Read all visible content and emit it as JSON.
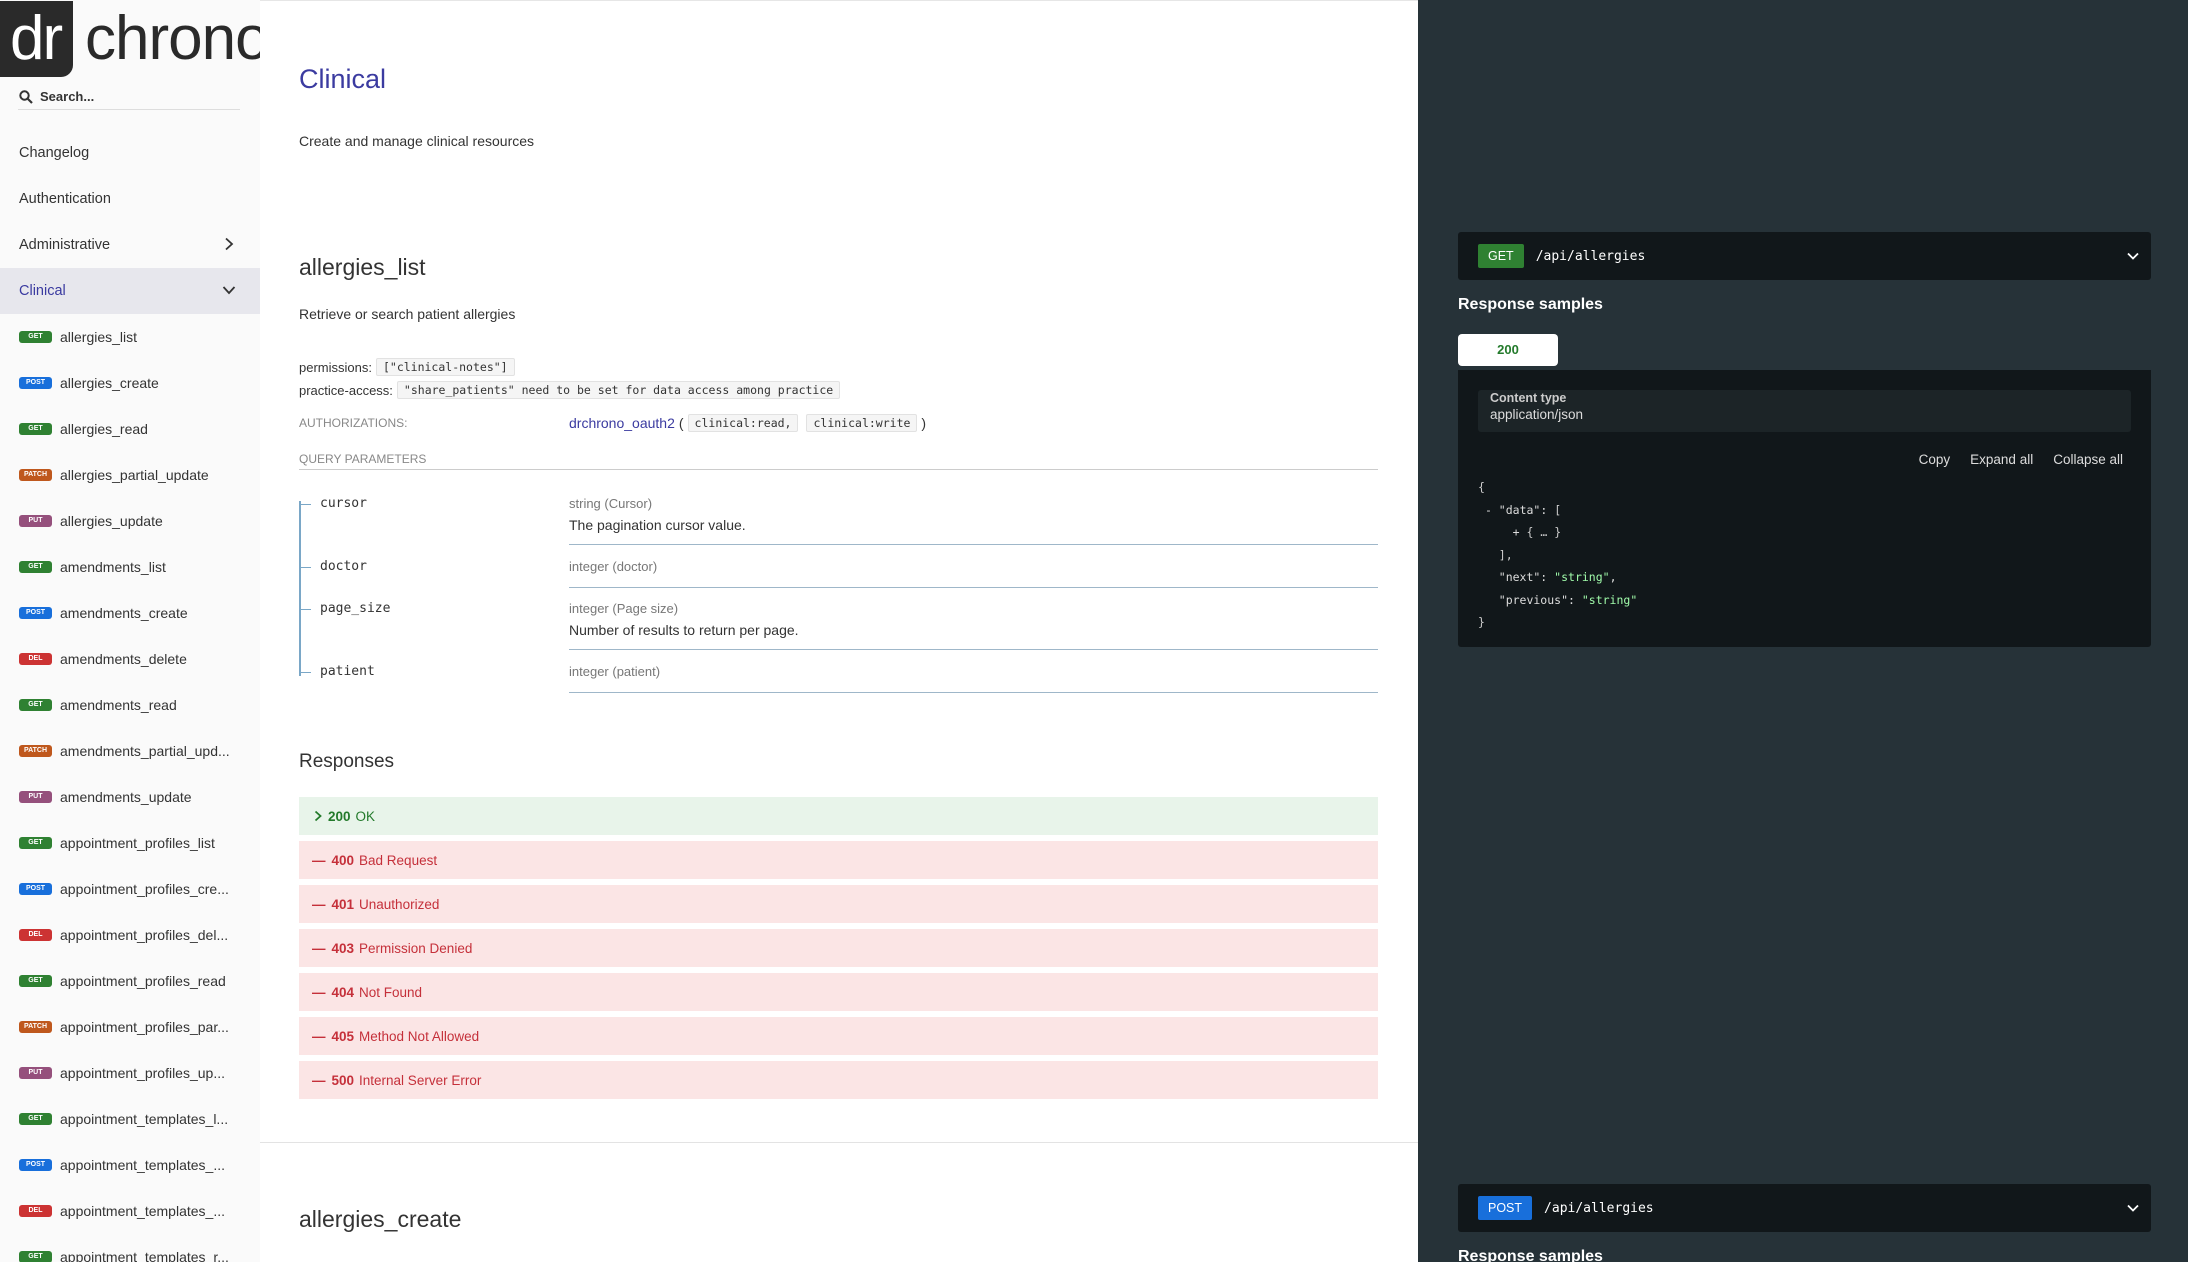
{
  "logo": {
    "box_text": "dr",
    "word": "chrono"
  },
  "search": {
    "placeholder": "Search..."
  },
  "nav": {
    "top_items": [
      {
        "label": "Changelog"
      },
      {
        "label": "Authentication"
      },
      {
        "label": "Administrative"
      },
      {
        "label": "Clinical"
      }
    ],
    "operations": [
      {
        "method": "GET",
        "label": "allergies_list"
      },
      {
        "method": "POST",
        "label": "allergies_create"
      },
      {
        "method": "GET",
        "label": "allergies_read"
      },
      {
        "method": "PATCH",
        "label": "allergies_partial_update"
      },
      {
        "method": "PUT",
        "label": "allergies_update"
      },
      {
        "method": "GET",
        "label": "amendments_list"
      },
      {
        "method": "POST",
        "label": "amendments_create"
      },
      {
        "method": "DEL",
        "label": "amendments_delete"
      },
      {
        "method": "GET",
        "label": "amendments_read"
      },
      {
        "method": "PATCH",
        "label": "amendments_partial_upd..."
      },
      {
        "method": "PUT",
        "label": "amendments_update"
      },
      {
        "method": "GET",
        "label": "appointment_profiles_list"
      },
      {
        "method": "POST",
        "label": "appointment_profiles_cre..."
      },
      {
        "method": "DEL",
        "label": "appointment_profiles_del..."
      },
      {
        "method": "GET",
        "label": "appointment_profiles_read"
      },
      {
        "method": "PATCH",
        "label": "appointment_profiles_par..."
      },
      {
        "method": "PUT",
        "label": "appointment_profiles_up..."
      },
      {
        "method": "GET",
        "label": "appointment_templates_l..."
      },
      {
        "method": "POST",
        "label": "appointment_templates_..."
      },
      {
        "method": "DEL",
        "label": "appointment_templates_..."
      },
      {
        "method": "GET",
        "label": "appointment_templates_r..."
      }
    ]
  },
  "main": {
    "section_title": "Clinical",
    "section_desc": "Create and manage clinical resources",
    "operation": {
      "title": "allergies_list",
      "desc": "Retrieve or search patient allergies",
      "permissions_label": "permissions:",
      "permissions_value": "[\"clinical-notes\"]",
      "practice_access_label": "practice-access:",
      "practice_access_value": "\"share_patients\" need to be set for data access among practice",
      "authorizations_label": "AUTHORIZATIONS:",
      "auth_name": "drchrono_oauth2",
      "auth_open": "(",
      "auth_close": ")",
      "auth_scopes": [
        "clinical:read,",
        "clinical:write"
      ],
      "query_params_label": "QUERY PARAMETERS",
      "params": [
        {
          "name": "cursor",
          "type": "string (Cursor)",
          "desc": "The pagination cursor value."
        },
        {
          "name": "doctor",
          "type": "integer (doctor)",
          "desc": ""
        },
        {
          "name": "page_size",
          "type": "integer (Page size)",
          "desc": "Number of results to return per page."
        },
        {
          "name": "patient",
          "type": "integer (patient)",
          "desc": ""
        }
      ],
      "responses_title": "Responses",
      "responses": [
        {
          "code": "200",
          "text": "OK",
          "kind": "ok"
        },
        {
          "code": "400",
          "text": "Bad Request",
          "kind": "err"
        },
        {
          "code": "401",
          "text": "Unauthorized",
          "kind": "err"
        },
        {
          "code": "403",
          "text": "Permission Denied",
          "kind": "err"
        },
        {
          "code": "404",
          "text": "Not Found",
          "kind": "err"
        },
        {
          "code": "405",
          "text": "Method Not Allowed",
          "kind": "err"
        },
        {
          "code": "500",
          "text": "Internal Server Error",
          "kind": "err"
        }
      ]
    },
    "next_operation_title": "allergies_create"
  },
  "right": {
    "endpoint1": {
      "method": "GET",
      "path": "/api/allergies"
    },
    "response_samples_title": "Response samples",
    "tab_label": "200",
    "content_type_label": "Content type",
    "content_type_value": "application/json",
    "tools": {
      "copy": "Copy",
      "expand": "Expand all",
      "collapse": "Collapse all"
    },
    "endpoint2": {
      "method": "POST",
      "path": "/api/allergies"
    }
  },
  "colors": {
    "accent": "#3b3ba0",
    "get": "#2f8132",
    "post": "#186fdb",
    "patch": "#bf581d",
    "put": "#95507c",
    "delete": "#cc3333",
    "right_panel": "#263238",
    "ok_bg": "#e8f4ea",
    "err_bg": "#fbe5e5"
  }
}
